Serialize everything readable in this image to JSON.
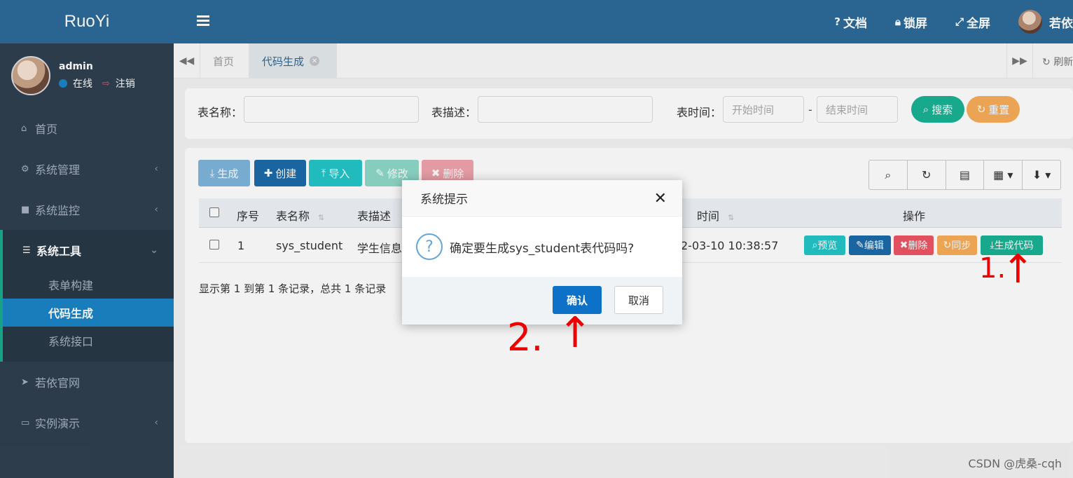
{
  "app": {
    "logo": "RuoYi"
  },
  "user": {
    "name": "admin",
    "status": "在线",
    "logout": "注销"
  },
  "sidebar": {
    "items": [
      {
        "label": "首页",
        "icon": "home-icon"
      },
      {
        "label": "系统管理",
        "icon": "gear-icon"
      },
      {
        "label": "系统监控",
        "icon": "video-icon"
      },
      {
        "label": "系统工具",
        "icon": "bars-icon"
      },
      {
        "label": "若依官网",
        "icon": "send-icon"
      },
      {
        "label": "实例演示",
        "icon": "desktop-icon"
      }
    ],
    "sub_items": [
      "表单构建",
      "代码生成",
      "系统接口"
    ],
    "active_sub": "代码生成"
  },
  "topbar": {
    "docs": "文档",
    "lock": "锁屏",
    "fullscreen": "全屏",
    "user": "若依"
  },
  "tabs": {
    "home": "首页",
    "current": "代码生成",
    "refresh": "刷新"
  },
  "search": {
    "table_name_label": "表名称：",
    "table_desc_label": "表描述：",
    "table_time_label": "表时间：",
    "start_placeholder": "开始时间",
    "end_placeholder": "结束时间",
    "range_sep": "-",
    "search_btn": "搜索",
    "reset_btn": "重置"
  },
  "toolbar": {
    "generate": "生成",
    "create": "创建",
    "import": "导入",
    "edit": "修改",
    "delete": "删除"
  },
  "table": {
    "headers": {
      "index": "序号",
      "name": "表名称",
      "desc": "表描述",
      "time": "时间",
      "ops": "操作"
    },
    "rows": [
      {
        "index": "1",
        "name": "sys_student",
        "desc": "学生信息",
        "time": "2-03-10 10:38:57"
      }
    ],
    "actions": {
      "preview": "预览",
      "edit": "编辑",
      "delete": "删除",
      "sync": "同步",
      "gen": "生成代码"
    },
    "footer": "显示第 1 到第 1 条记录，总共 1 条记录"
  },
  "modal": {
    "title": "系统提示",
    "message": "确定要生成sys_student表代码吗?",
    "confirm": "确认",
    "cancel": "取消"
  },
  "annotations": {
    "first": "1.",
    "second": "2.",
    "arrow": "↑"
  },
  "watermark": "CSDN @虎桑-cqh",
  "colors": {
    "sidebar_bg": "#2f4050",
    "topbar_bg": "#2d6a98",
    "primary": "#1c84c6",
    "success": "#1ab394",
    "warning": "#f8ac59",
    "danger": "#ed5565",
    "info": "#23c6c8"
  }
}
